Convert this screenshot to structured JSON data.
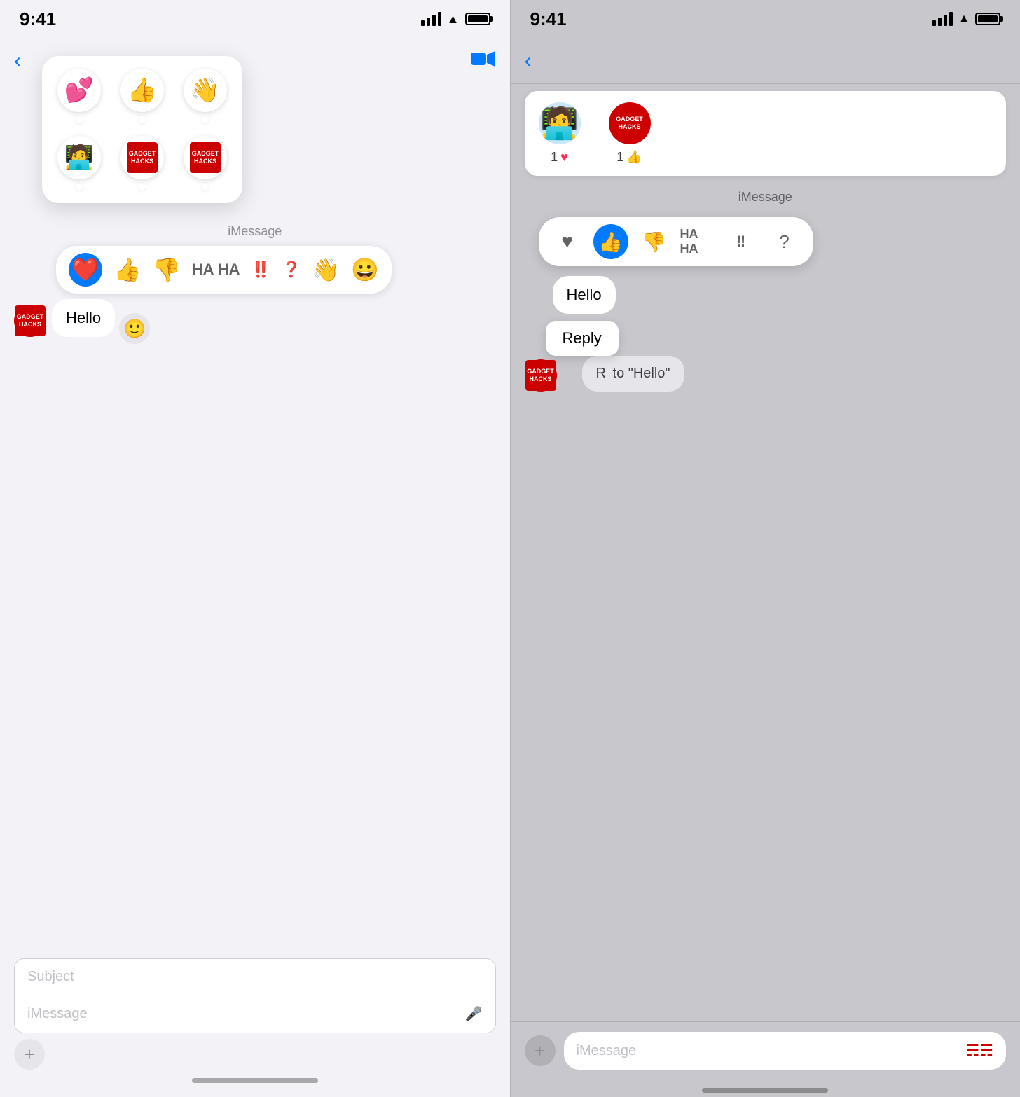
{
  "left_panel": {
    "status_time": "9:41",
    "imessage_label": "iMessage",
    "message_hello": "Hello",
    "subject_placeholder": "Subject",
    "message_placeholder": "iMessage",
    "tapback_emojis": [
      "❤️",
      "👍",
      "👎",
      "😄",
      "‼️",
      "❓",
      "👋",
      "😀"
    ],
    "reaction_emojis_top": [
      "💕",
      "👍",
      "👋"
    ],
    "reaction_emojis_bottom": [
      "🧑‍💻",
      "GADGET HACKS",
      "GADGET HACKS"
    ],
    "plus_label": "+",
    "active_tapback_index": 0
  },
  "right_panel": {
    "status_time": "9:41",
    "imessage_label": "iMessage",
    "hello_bubble": "Hello",
    "reply_text": "Reply",
    "reaction_bubble_text": "R",
    "partial_message": "to \"Hello\"",
    "message_placeholder": "iMessage",
    "plus_label": "+",
    "reactions_header": {
      "person1_count": "1",
      "person1_reaction": "♥",
      "person2_count": "1",
      "person2_reaction": "👍"
    },
    "tapback_items": [
      "♥",
      "👍",
      "👎",
      "HA HA",
      "‼",
      "?"
    ]
  }
}
